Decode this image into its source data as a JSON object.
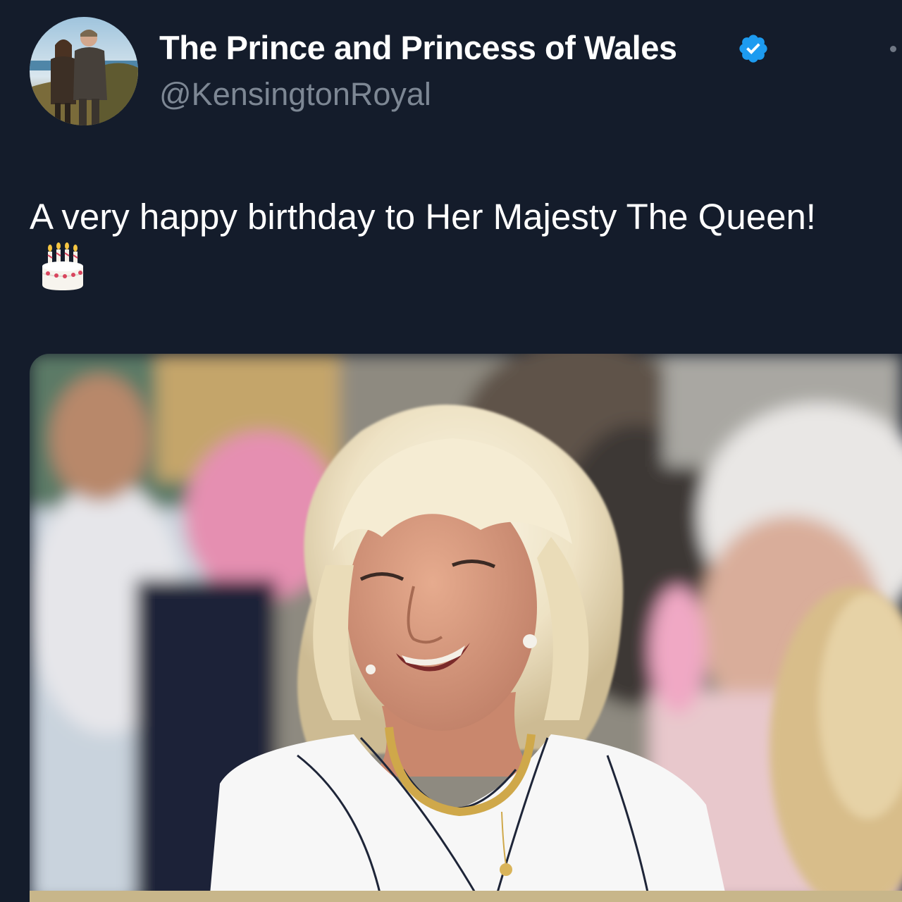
{
  "profile": {
    "display_name": "The Prince and Princess of Wales",
    "handle": "@KensingtonRoyal",
    "verified": true,
    "avatar_icon": "avatar-photo",
    "verified_icon": "verified-badge-icon",
    "verified_color": "#1d9bf0"
  },
  "tweet": {
    "text": "A very happy birthday to Her Majesty The Queen!",
    "emoji_icon": "birthday-cake-icon"
  },
  "media": {
    "type": "photo"
  },
  "menu": {
    "icon": "more-options-icon"
  },
  "colors": {
    "background": "#141c2b",
    "text": "#ffffff",
    "secondary_text": "#7d8794"
  }
}
